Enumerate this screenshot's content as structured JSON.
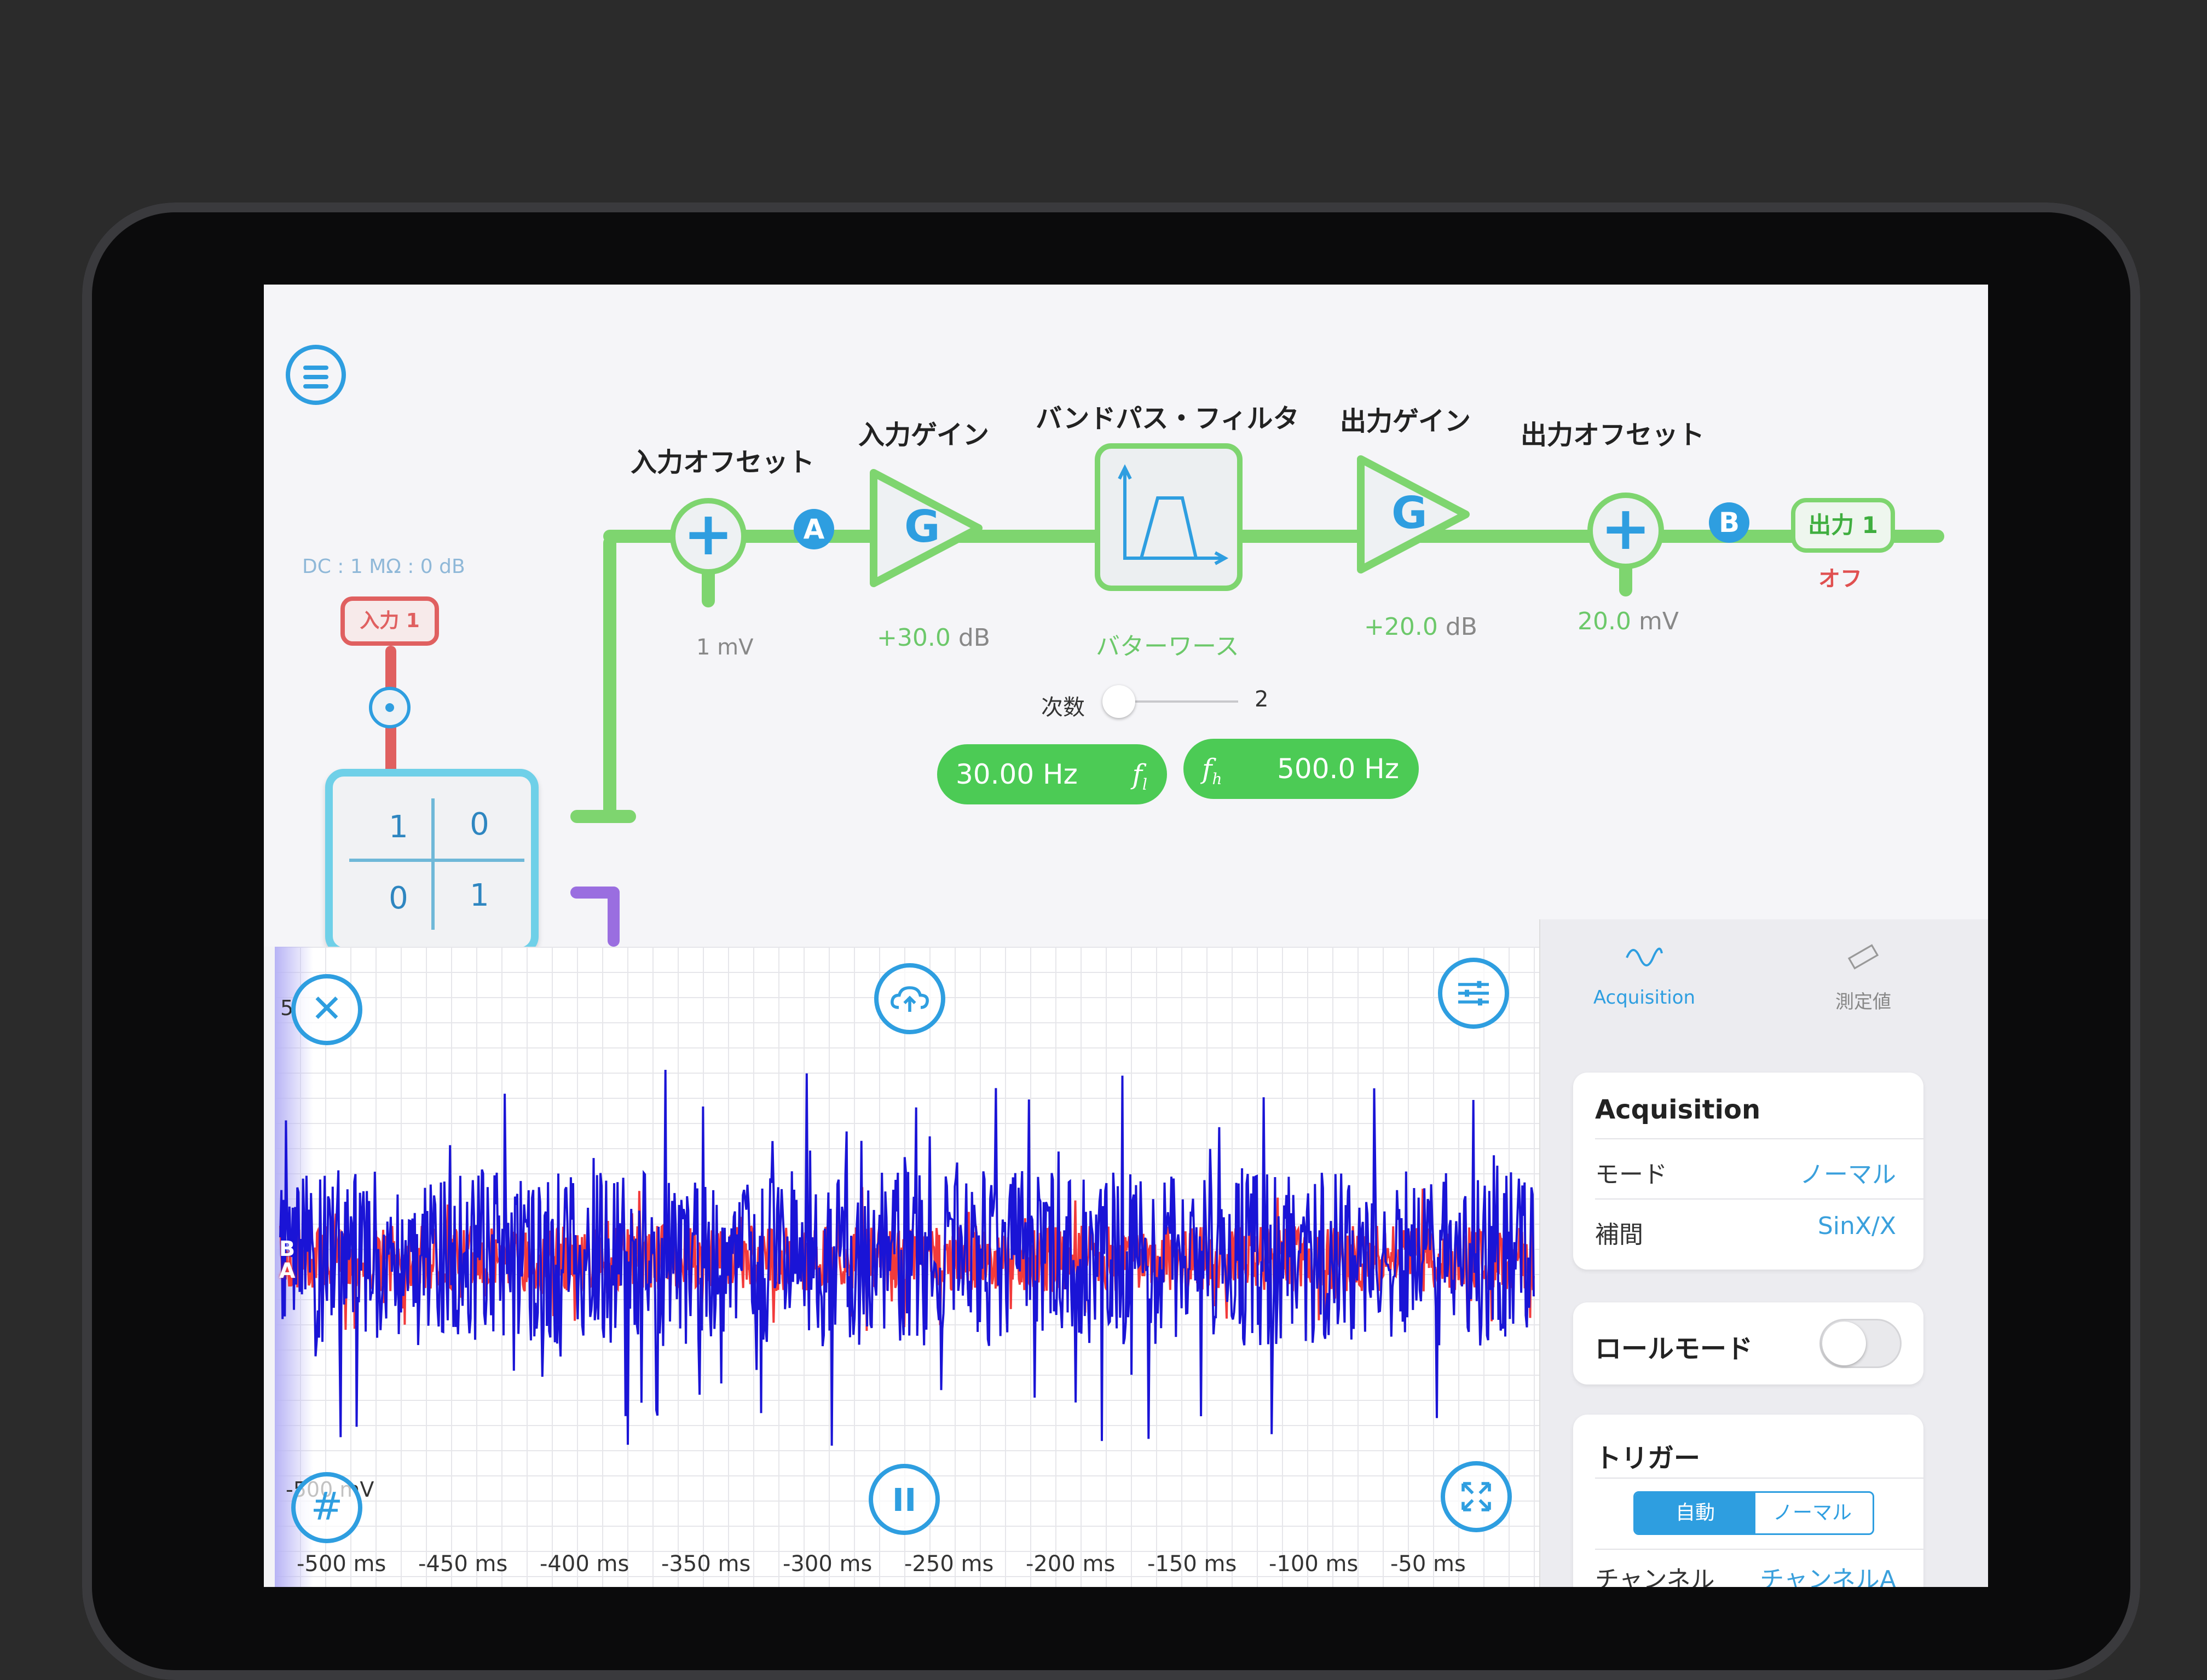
{
  "diagram": {
    "input_coupling": "DC : 1 MΩ : 0 dB",
    "input_label": "入力 1",
    "matrix": [
      "1",
      "0",
      "0",
      "1"
    ],
    "blocks": {
      "input_offset": {
        "title": "入力オフセット",
        "value": "1 mV"
      },
      "input_gain": {
        "title": "入力ゲイン",
        "letter": "G",
        "value": "+30.0",
        "unit": "dB"
      },
      "bandpass": {
        "title": "バンドパス・フィルタ",
        "type": "バターワース"
      },
      "output_gain": {
        "title": "出力ゲイン",
        "letter": "G",
        "value": "+20.0",
        "unit": "dB"
      },
      "output_offset": {
        "title": "出力オフセット",
        "value": "20.0",
        "unit": "mV"
      }
    },
    "node_a": "A",
    "node_b": "B",
    "output_label": "出力 1",
    "output_state": "オフ",
    "order_label": "次数",
    "order_value": "2",
    "f_low": "30.00 Hz",
    "f_low_symbol": "f",
    "f_low_sub": "l",
    "f_high": "500.0 Hz",
    "f_high_symbol": "f",
    "f_high_sub": "h"
  },
  "scope": {
    "y_top": "5",
    "y_bottom": "-500 mV",
    "channel_b": "B",
    "channel_a": "A",
    "x_ticks": [
      "-500 ms",
      "-450 ms",
      "-400 ms",
      "-350 ms",
      "-300 ms",
      "-250 ms",
      "-200 ms",
      "-150 ms",
      "-100 ms",
      "-50 ms"
    ],
    "colors": {
      "channel_a": "#f23b3b",
      "channel_b": "#1a14d6"
    }
  },
  "panel": {
    "tabs": [
      {
        "label": "Acquisition",
        "icon": "sine-wave-icon"
      },
      {
        "label": "測定値",
        "icon": "ruler-icon"
      }
    ],
    "acquisition": {
      "title": "Acquisition",
      "mode_label": "モード",
      "mode_value": "ノーマル",
      "interp_label": "補間",
      "interp_value": "SinX/X"
    },
    "roll_mode_label": "ロールモード",
    "trigger": {
      "title": "トリガー",
      "segments": [
        "自動",
        "ノーマル"
      ],
      "channel_label": "チャンネル",
      "channel_value": "チャンネルA"
    }
  },
  "accent_colors": {
    "blue": "#2e9ee0",
    "green": "#7ed56f",
    "red": "#e06060"
  }
}
